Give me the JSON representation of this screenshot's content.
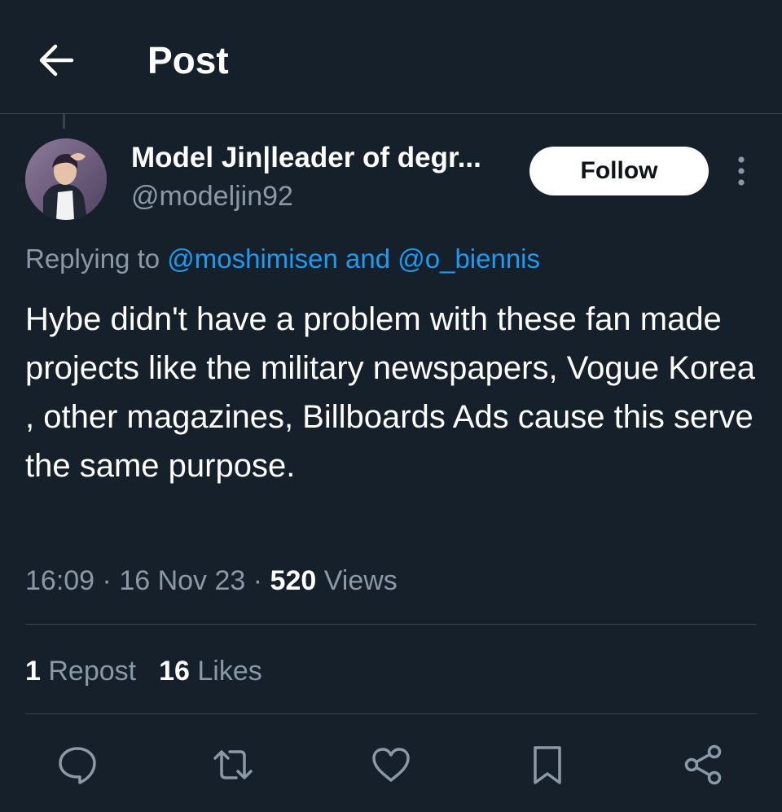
{
  "header": {
    "back_icon": "arrow-left-icon",
    "title": "Post"
  },
  "author": {
    "display_name": "Model Jin|leader of degr...",
    "handle": "@modeljin92",
    "follow_label": "Follow",
    "more_icon": "more-vertical-icon"
  },
  "reply_context": {
    "prefix": "Replying to ",
    "mention_1": "@moshimisen",
    "joiner": " and ",
    "mention_2": "@o_biennis"
  },
  "tweet": {
    "text": "Hybe didn't have a problem with these fan made projects like the military newspapers, Vogue Korea , other magazines, Billboards Ads cause this serve the same purpose."
  },
  "meta": {
    "time": "16:09",
    "separator_1": " · ",
    "date": "16 Nov 23",
    "separator_2": " · ",
    "views_count": "520",
    "views_label": " Views"
  },
  "stats": {
    "reposts_count": "1",
    "reposts_label": " Repost",
    "likes_count": "16",
    "likes_label": " Likes"
  },
  "actions": [
    {
      "icon": "reply-icon"
    },
    {
      "icon": "repost-icon"
    },
    {
      "icon": "like-icon"
    },
    {
      "icon": "bookmark-icon"
    },
    {
      "icon": "share-icon"
    }
  ],
  "colors": {
    "background": "#15202b",
    "secondary_text": "#8b98a5",
    "mention": "#1d9bf0",
    "divider": "#38444d"
  }
}
